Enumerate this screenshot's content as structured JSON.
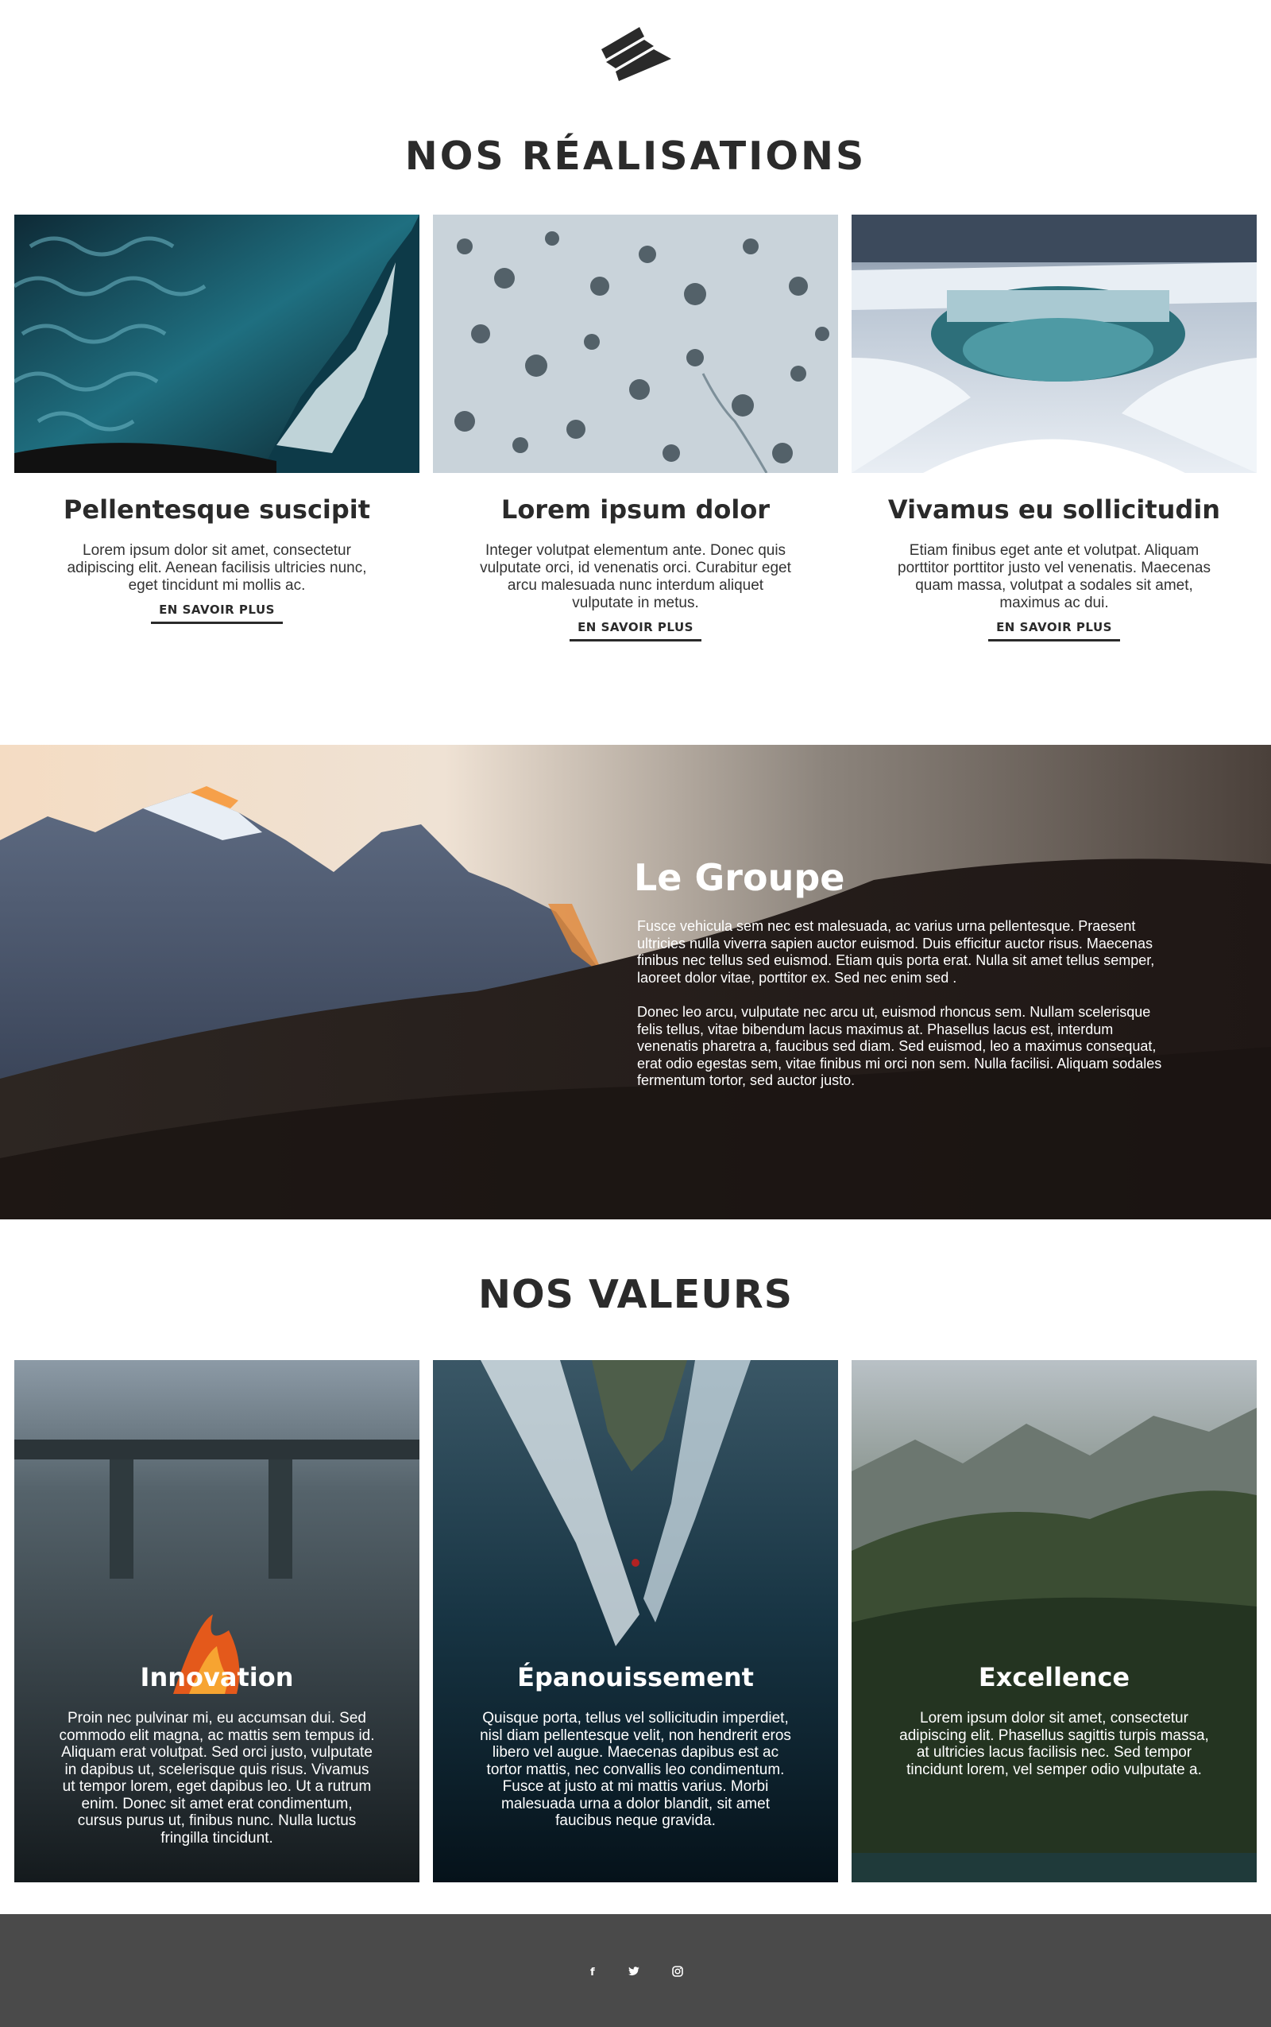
{
  "header": {
    "logo_icon": "brand-logo-icon"
  },
  "realisations": {
    "title": "NOS RÉALISATIONS",
    "cards": [
      {
        "title": "Pellentesque suscipit",
        "text": "Lorem ipsum dolor sit amet, consectetur adipiscing elit. Aenean facilisis ultricies nunc, eget tincidunt mi mollis ac.",
        "link": "EN SAVOIR PLUS",
        "image": "ice-cave-photo"
      },
      {
        "title": "Lorem ipsum dolor",
        "text": "Integer volutpat elementum ante. Donec quis vulputate orci, id venenatis orci. Curabitur eget arcu malesuada nunc interdum aliquet vulputate in metus.",
        "link": "EN SAVOIR PLUS",
        "image": "snowy-forest-aerial-photo"
      },
      {
        "title": "Vivamus eu sollicitudin",
        "text": "Etiam finibus eget ante et volutpat. Aliquam porttitor porttitor justo vel venenatis. Maecenas quam massa, volutpat a sodales sit amet, maximus ac dui.",
        "link": "EN SAVOIR PLUS",
        "image": "frozen-waterfall-photo"
      }
    ]
  },
  "groupe": {
    "title": "Le Groupe",
    "paragraph1": "Fusce vehicula sem nec est malesuada, ac varius urna pellentesque. Praesent ultricies nulla viverra sapien auctor euismod. Duis efficitur auctor risus. Maecenas finibus nec tellus sed euismod. Etiam quis porta erat. Nulla sit amet tellus semper, laoreet dolor vitae, porttitor ex. Sed nec enim sed .",
    "paragraph2": "Donec leo arcu, vulputate nec arcu ut, euismod rhoncus sem. Nullam scelerisque felis tellus, vitae bibendum lacus maximus at. Phasellus lacus est, interdum venenatis pharetra a, faucibus sed diam. Sed euismod, leo a maximus consequat, erat odio egestas sem, vitae finibus mi orci non sem. Nulla facilisi. Aliquam sodales fermentum tortor, sed auctor justo.",
    "image": "mountain-sunset-photo"
  },
  "valeurs": {
    "title": "NOS VALEURS",
    "cards": [
      {
        "title": "Innovation",
        "text": "Proin nec pulvinar mi, eu accumsan dui. Sed commodo elit magna, ac mattis sem tempus id. Aliquam erat volutpat. Sed orci justo, vulputate in dapibus ut, scelerisque quis risus. Vivamus ut tempor lorem, eget dapibus leo. Ut a rutrum enim. Donec sit amet erat condimentum, cursus purus ut, finibus nunc. Nulla luctus fringilla tincidunt.",
        "image": "campfire-photo"
      },
      {
        "title": "Épanouissement",
        "text": "Quisque porta, tellus vel sollicitudin imperdiet, nisl diam pellentesque velit, non hendrerit eros libero vel augue. Maecenas dapibus est ac tortor mattis, nec convallis leo condimentum. Fusce at justo at mi mattis varius. Morbi malesuada urna a dolor blandit, sit amet faucibus neque gravida.",
        "image": "glacier-crevasse-photo"
      },
      {
        "title": "Excellence",
        "text": "Lorem ipsum dolor sit amet, consectetur adipiscing elit. Phasellus sagittis turpis massa, at ultricies lacus facilisis nec. Sed tempor tincidunt lorem, vel semper odio vulputate a.",
        "image": "forest-mountain-photo"
      }
    ]
  },
  "footer": {
    "social": [
      {
        "icon": "facebook-icon",
        "glyph": "f"
      },
      {
        "icon": "twitter-icon",
        "glyph": ""
      },
      {
        "icon": "instagram-icon",
        "glyph": ""
      }
    ],
    "background": "#4a4a4a"
  }
}
